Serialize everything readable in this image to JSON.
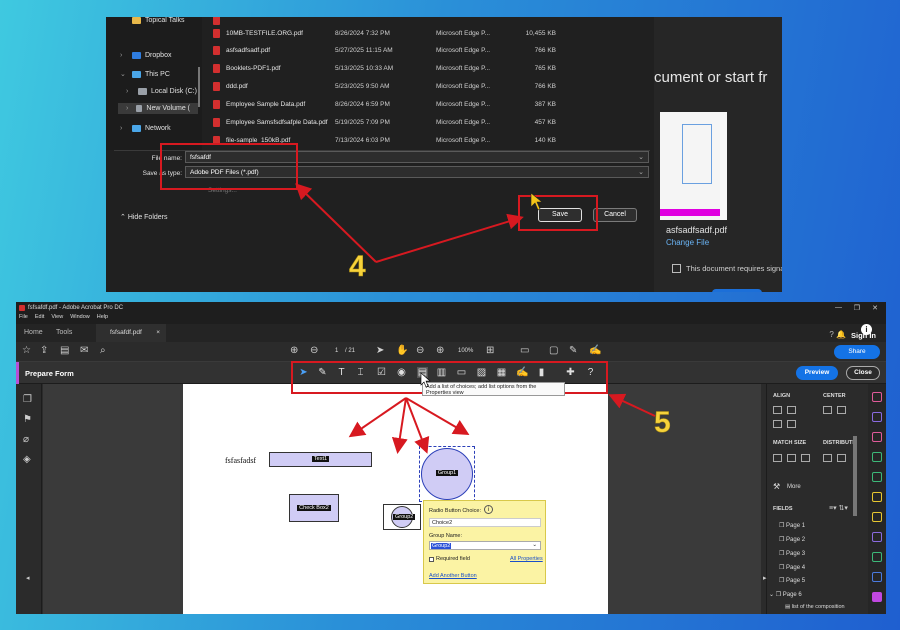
{
  "save_dialog": {
    "nav": [
      {
        "label": "Topical Talks",
        "icon": "folder-icon"
      },
      {
        "label": "Dropbox",
        "icon": "dropbox-icon"
      },
      {
        "label": "This PC",
        "icon": "computer-icon"
      },
      {
        "label": "Local Disk (C:)",
        "icon": "disk-icon"
      },
      {
        "label": "New Volume (",
        "icon": "disk-icon"
      },
      {
        "label": "Network",
        "icon": "network-icon"
      }
    ],
    "files": [
      {
        "name": "10MB-TESTFILE.ORG.pdf",
        "date": "8/26/2024 7:32 PM",
        "type": "Microsoft Edge P...",
        "size": "10,455 KB"
      },
      {
        "name": "asfsadfsadf.pdf",
        "date": "5/27/2025 11:15 AM",
        "type": "Microsoft Edge P...",
        "size": "766 KB"
      },
      {
        "name": "Booklets-PDF1.pdf",
        "date": "5/13/2025 10:33 AM",
        "type": "Microsoft Edge P...",
        "size": "765 KB"
      },
      {
        "name": "ddd.pdf",
        "date": "5/23/2025 9:50 AM",
        "type": "Microsoft Edge P...",
        "size": "766 KB"
      },
      {
        "name": "Employee Sample Data.pdf",
        "date": "8/26/2024 6:59 PM",
        "type": "Microsoft Edge P...",
        "size": "387 KB"
      },
      {
        "name": "Employee Samsfsdfsafple Data.pdf",
        "date": "5/19/2025 7:09 PM",
        "type": "Microsoft Edge P...",
        "size": "457 KB"
      },
      {
        "name": "file-sample_150kB.pdf",
        "date": "7/13/2024 6:03 PM",
        "type": "Microsoft Edge P...",
        "size": "140 KB"
      }
    ],
    "file_name_label": "File name:",
    "file_name_value": "fsfsafdf",
    "save_type_label": "Save as type:",
    "save_type_value": "Adobe PDF Files (*.pdf)",
    "settings_label": "Settings...",
    "hide_folders": "Hide Folders",
    "save": "Save",
    "cancel": "Cancel",
    "right_text": "cument or start fr",
    "thumb_filename": "asfsadfsadf.pdf",
    "change_file": "Change File",
    "requires_signatures": "This document requires signatures"
  },
  "step_labels": {
    "step4": "4",
    "step5": "5"
  },
  "acrobat": {
    "window_title": "fsfsafdf.pdf - Adobe Acrobat Pro DC",
    "menu": [
      "File",
      "Edit",
      "View",
      "Window",
      "Help"
    ],
    "tabs": {
      "home": "Home",
      "tools": "Tools",
      "doc": "fsfsafdf.pdf",
      "doc_close": "×"
    },
    "sign_in": "Sign In",
    "page_current": "1",
    "page_total": "/ 21",
    "zoom": "100%",
    "share": "Share",
    "prepare_form": "Prepare Form",
    "preview": "Preview",
    "close": "Close",
    "tooltip": "Add a list of choices; add list options from the Properties view",
    "page_text": "fsfasfadsf",
    "fields": {
      "text1": "Text1",
      "check1": "Check Box2",
      "group1": "Group1",
      "group2": "Group2"
    },
    "popup": {
      "title": "Radio Button Choice:",
      "choice_value": "Choice2",
      "group_name_label": "Group Name:",
      "group_name_value": "Group2",
      "required": "Required field",
      "all_properties": "All Properties",
      "add_another": "Add Another Button"
    },
    "right_panel": {
      "align": "ALIGN",
      "center": "CENTER",
      "match_size": "MATCH SIZE",
      "distribute": "DISTRIBUTE",
      "more": "More",
      "fields": "FIELDS",
      "pages": [
        "Page 1",
        "Page 2",
        "Page 3",
        "Page 4",
        "Page 5",
        "Page 6"
      ],
      "last_item": "list of the composition"
    }
  },
  "colors": {
    "highlight": "#d71920",
    "accent_blue": "#1473e6",
    "step_yellow": "#f6d23b",
    "field_fill": "#d0ccf5",
    "popup_fill": "#fbf3a4"
  }
}
